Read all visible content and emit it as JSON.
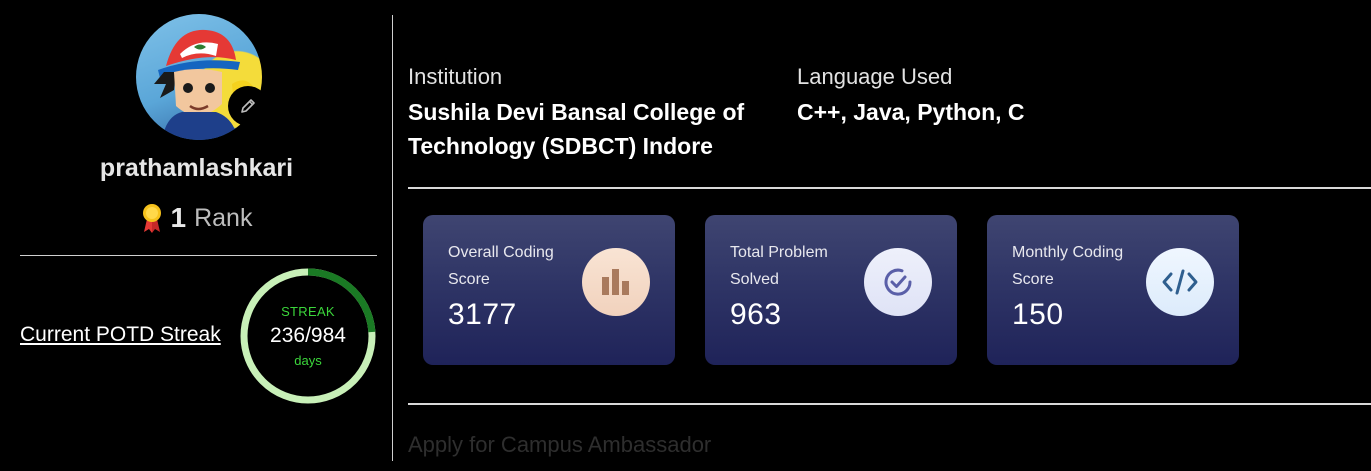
{
  "profile": {
    "username": "prathamlashkari",
    "rank_number": "1",
    "rank_label": "Rank"
  },
  "streak": {
    "link_label": "Current POTD Streak",
    "label": "STREAK",
    "value": "236/984",
    "current": 236,
    "total": 984,
    "unit": "days"
  },
  "details": {
    "institution_label": "Institution",
    "institution_value": "Sushila Devi Bansal College of Technology (SDBCT) Indore",
    "language_label": "Language Used",
    "language_value": "C++, Java, Python, C"
  },
  "cards": [
    {
      "title": "Overall Coding Score",
      "value": "3177",
      "icon": "bar-chart-icon"
    },
    {
      "title": "Total Problem Solved",
      "value": "963",
      "icon": "check-circle-icon"
    },
    {
      "title": "Monthly Coding Score",
      "value": "150",
      "icon": "code-icon"
    }
  ],
  "footer": {
    "apply_label": "Apply for Campus Ambassador"
  },
  "colors": {
    "background": "#000000",
    "streak_green": "#3bd63b",
    "ring_dark": "#1a7a24",
    "ring_light": "#c8f0b8",
    "card_top": "#3f4571",
    "card_bottom": "#1f2359"
  }
}
